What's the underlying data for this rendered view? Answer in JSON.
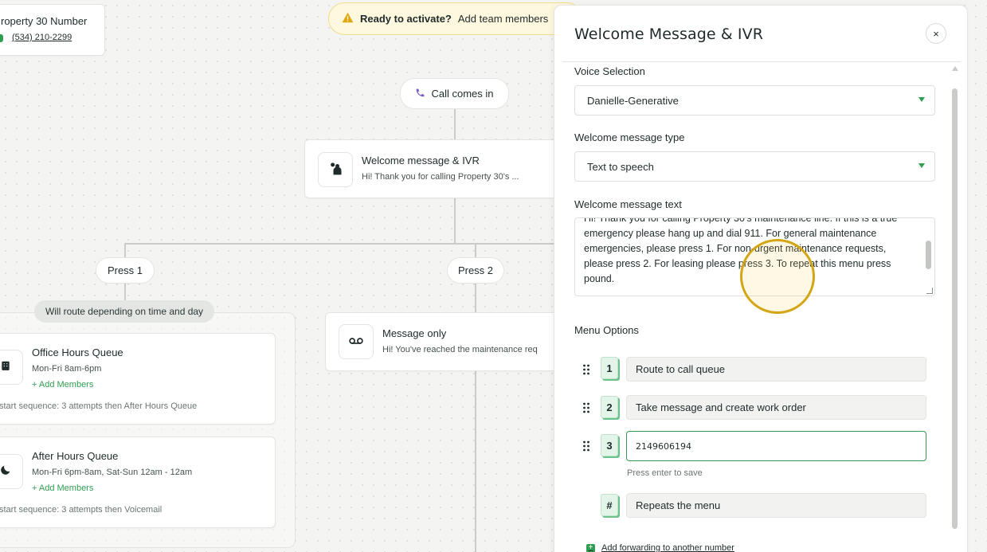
{
  "banner": {
    "bold": "Ready to activate?",
    "text": "Add team members"
  },
  "top_card": {
    "title": "roperty 30 Number",
    "phone": "(534) 210-2299"
  },
  "flow": {
    "start_label": "Call comes in",
    "ivr_node": {
      "title": "Welcome message & IVR",
      "subtitle": "Hi! Thank you for calling Property 30's ..."
    },
    "press1_label": "Press 1",
    "press2_label": "Press 2",
    "route_pill": "Will route depending on time and day",
    "office_queue": {
      "title": "Office Hours Queue",
      "hours": "Mon-Fri 8am-6pm",
      "add_members": "+ Add Members",
      "sequence": "start sequence: 3 attempts then After Hours Queue"
    },
    "after_queue": {
      "title": "After Hours Queue",
      "hours": "Mon-Fri 6pm-8am, Sat-Sun 12am - 12am",
      "add_members": "+ Add Members",
      "sequence": "start sequence: 3 attempts then Voicemail"
    },
    "message_node": {
      "title": "Message only",
      "subtitle": "Hi! You've reached the maintenance req"
    }
  },
  "panel": {
    "title": "Welcome Message & IVR",
    "close_icon": "×",
    "voice_label": "Voice Selection",
    "voice_value": "Danielle-Generative",
    "type_label": "Welcome message type",
    "type_value": "Text to speech",
    "text_label": "Welcome message text",
    "text_value": "Hi! Thank you for calling Property 30's maintenance line. If this is a true emergency please hang up and dial 911. For general maintenance emergencies, please press 1. For non-urgent maintenance requests, please press 2. For leasing please press 3. To repeat this menu press pound.",
    "menu_title": "Menu Options",
    "options": [
      {
        "key": "1",
        "value": "Route to call queue"
      },
      {
        "key": "2",
        "value": "Take message and create work order"
      },
      {
        "key": "3",
        "value": "2149606194"
      },
      {
        "key": "#",
        "value": "Repeats the menu"
      }
    ],
    "hint": "Press enter to save",
    "forward_link": "Add forwarding to another number"
  },
  "colors": {
    "accent": "#2f9e53",
    "banner_bg": "#fdf8de",
    "cursor_ring": "#d4a514"
  }
}
